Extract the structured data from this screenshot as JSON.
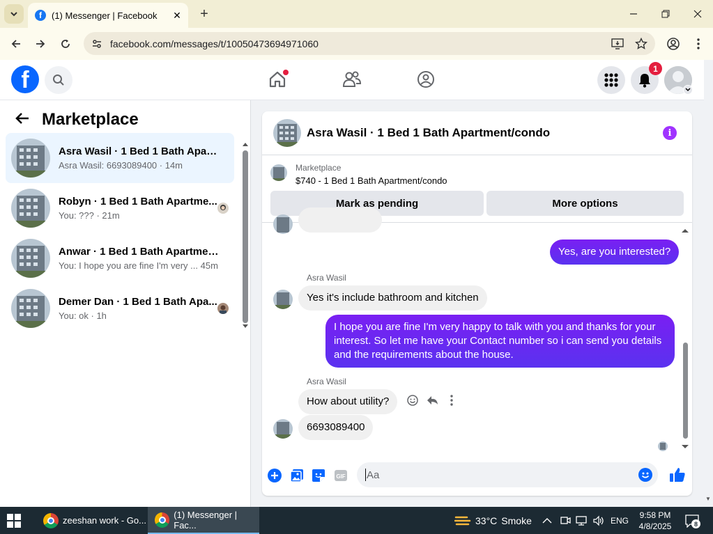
{
  "browser": {
    "tab_title": "(1) Messenger | Facebook",
    "url": "facebook.com/messages/t/10050473694971060"
  },
  "fb_header": {
    "logo_letter": "f",
    "notification_count": "1"
  },
  "left_panel": {
    "title": "Marketplace",
    "conversations": [
      {
        "name": "Asra Wasil · 1 Bed 1 Bath Apartm...",
        "preview": "Asra Wasil: 6693089400 · 14m",
        "active": true
      },
      {
        "name": "Robyn · 1 Bed 1 Bath Apartme...",
        "preview": "You: ??? · 21m"
      },
      {
        "name": "Anwar · 1 Bed 1 Bath Apartment...",
        "preview": "You: I hope you are fine I'm very ...  45m"
      },
      {
        "name": "Demer Dan · 1 Bed 1 Bath Apa...",
        "preview": "You: ok · 1h"
      }
    ]
  },
  "chat": {
    "title": "Asra Wasil · 1 Bed 1 Bath Apartment/condo",
    "marketplace_label": "Marketplace",
    "listing": "$740 - 1 Bed 1 Bath Apartment/condo",
    "mark_pending_label": "Mark as pending",
    "more_options_label": "More options",
    "messages": {
      "m1_out": "Yes, are you interested?",
      "m2_sender": "Asra Wasil",
      "m2_in": "Yes it's include bathroom and kitchen",
      "m3_out": "I hope you are fine I'm very happy to talk with you and thanks for your interest. So let me have your Contact number so i can send you details and the requirements about the house.",
      "m4_sender": "Asra Wasil",
      "m4_in": "How about utility?",
      "m5_in": "6693089400"
    },
    "composer_placeholder": "Aa"
  },
  "taskbar": {
    "app1": "zeeshan work - Go...",
    "app2": "(1) Messenger | Fac...",
    "weather_temp": "33°C",
    "weather_text": "Smoke",
    "lang": "ENG",
    "time": "9:58 PM",
    "date": "4/8/2025",
    "notif_count": "8"
  },
  "colors": {
    "fb_blue": "#0866ff",
    "bubble_out": "#6a2af0",
    "bubble_in": "#f0f0f0",
    "info_purple": "#a033ff"
  }
}
